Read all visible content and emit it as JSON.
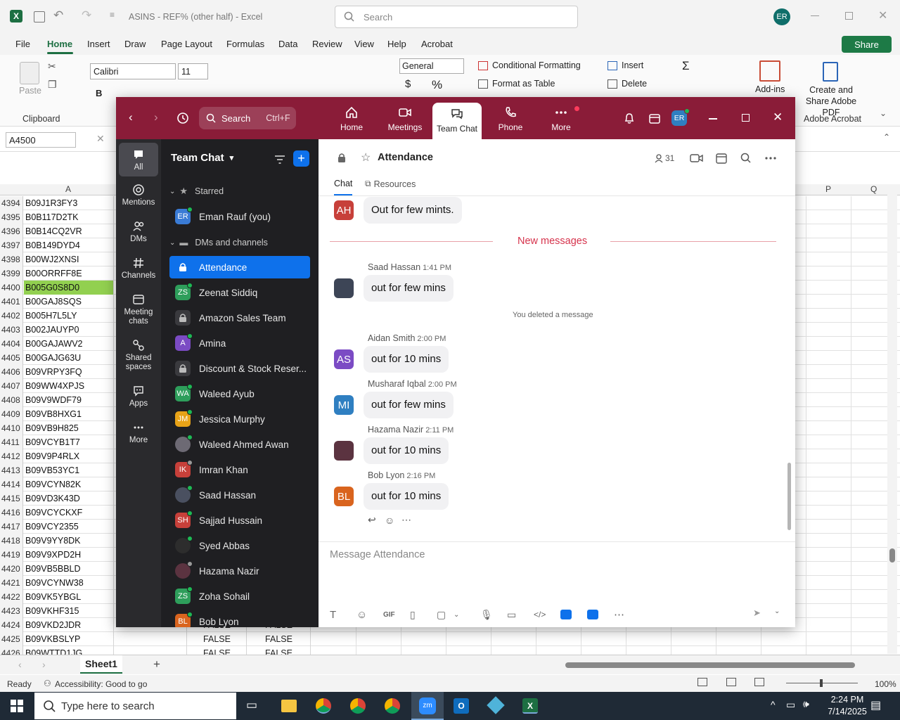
{
  "excel": {
    "title": "ASINS - REF% (other half)  -  Excel",
    "search_placeholder": "Search",
    "user_initials": "ER",
    "menu": [
      "File",
      "Home",
      "Insert",
      "Draw",
      "Page Layout",
      "Formulas",
      "Data",
      "Review",
      "View",
      "Help",
      "Acrobat"
    ],
    "share_label": "Share",
    "ribbon": {
      "paste": "Paste",
      "clipboard": "Clipboard",
      "font_name": "Calibri",
      "font_size": "11",
      "number_format": "General",
      "conditional_formatting": "Conditional Formatting",
      "format_as_table": "Format as Table",
      "insert": "Insert",
      "delete": "Delete",
      "addins": "Add-ins",
      "create_share_pdf": "Create and Share Adobe PDF",
      "adobe_acrobat": "Adobe Acrobat"
    },
    "name_box": "A4500",
    "col_a": "A",
    "col_p": "P",
    "col_q": "Q",
    "rows": [
      {
        "n": "4394",
        "a": "B09J1R3FY3"
      },
      {
        "n": "4395",
        "a": "B0B117D2TK"
      },
      {
        "n": "4396",
        "a": "B0B14CQ2VR"
      },
      {
        "n": "4397",
        "a": "B0B149DYD4"
      },
      {
        "n": "4398",
        "a": "B00WJ2XNSI"
      },
      {
        "n": "4399",
        "a": "B00ORRFF8E"
      },
      {
        "n": "4400",
        "a": "B005G0S8D0"
      },
      {
        "n": "4401",
        "a": "B00GAJ8SQS"
      },
      {
        "n": "4402",
        "a": "B005H7L5LY"
      },
      {
        "n": "4403",
        "a": "B002JAUYP0"
      },
      {
        "n": "4404",
        "a": "B00GAJAWV2"
      },
      {
        "n": "4405",
        "a": "B00GAJG63U"
      },
      {
        "n": "4406",
        "a": "B09VRPY3FQ"
      },
      {
        "n": "4407",
        "a": "B09WW4XPJS"
      },
      {
        "n": "4408",
        "a": "B09V9WDF79"
      },
      {
        "n": "4409",
        "a": "B09VB8HXG1"
      },
      {
        "n": "4410",
        "a": "B09VB9H825"
      },
      {
        "n": "4411",
        "a": "B09VCYB1T7"
      },
      {
        "n": "4412",
        "a": "B09V9P4RLX"
      },
      {
        "n": "4413",
        "a": "B09VB53YC1"
      },
      {
        "n": "4414",
        "a": "B09VCYN82K"
      },
      {
        "n": "4415",
        "a": "B09VD3K43D"
      },
      {
        "n": "4416",
        "a": "B09VCYCKXF"
      },
      {
        "n": "4417",
        "a": "B09VCY2355"
      },
      {
        "n": "4418",
        "a": "B09V9YY8DK"
      },
      {
        "n": "4419",
        "a": "B09V9XPD2H"
      },
      {
        "n": "4420",
        "a": "B09VB5BBLD"
      },
      {
        "n": "4421",
        "a": "B09VCYNW38"
      },
      {
        "n": "4422",
        "a": "B09VK5YBGL"
      },
      {
        "n": "4423",
        "a": "B09VKHF315"
      },
      {
        "n": "4424",
        "a": "B09VKD2JDR",
        "c": "FALSE",
        "d": "FALSE"
      },
      {
        "n": "4425",
        "a": "B09VKBSLYP",
        "c": "FALSE",
        "d": "FALSE"
      },
      {
        "n": "4426",
        "a": "B09WTTD1JG",
        "c": "FALSE",
        "d": "FALSE"
      }
    ],
    "sheet_tab": "Sheet1",
    "status_ready": "Ready",
    "accessibility": "Accessibility: Good to go",
    "zoom_pct": "100%",
    "highlight_color": "#92d050"
  },
  "zoom": {
    "search_label": "Search",
    "search_shortcut": "Ctrl+F",
    "nav": [
      "Home",
      "Meetings",
      "Team Chat",
      "Phone",
      "More"
    ],
    "avatar": "ER",
    "rail": [
      "All",
      "Mentions",
      "DMs",
      "Channels",
      "Meeting chats",
      "Shared spaces",
      "Apps",
      "More"
    ],
    "list_title": "Team Chat",
    "section_starred": "Starred",
    "section_dms": "DMs and channels",
    "starred_self": {
      "initials": "ER",
      "name": "Eman Rauf (you)",
      "color": "#3a7bd5"
    },
    "channels": [
      {
        "initials": "",
        "name": "Attendance",
        "type": "lock",
        "color": "#ffffff",
        "status": ""
      },
      {
        "initials": "ZS",
        "name": "Zeenat Siddiq",
        "type": "user",
        "color": "#2e9e5b",
        "status": "#1db954"
      },
      {
        "initials": "",
        "name": "Amazon Sales Team",
        "type": "lock",
        "color": "#3a3a3e",
        "status": ""
      },
      {
        "initials": "A",
        "name": "Amina",
        "type": "user",
        "color": "#7b4bc4",
        "status": "#1db954"
      },
      {
        "initials": "",
        "name": "Discount & Stock Reser...",
        "type": "lock",
        "color": "#3a3a3e",
        "status": ""
      },
      {
        "initials": "WA",
        "name": "Waleed Ayub",
        "type": "user",
        "color": "#2e9e5b",
        "status": "#1db954"
      },
      {
        "initials": "JM",
        "name": "Jessica Murphy",
        "type": "user",
        "color": "#e8a317",
        "status": "#1db954"
      },
      {
        "initials": "",
        "name": "Waleed Ahmed Awan",
        "type": "photo",
        "color": "#6d6a74",
        "status": "#1db954"
      },
      {
        "initials": "IK",
        "name": "Imran Khan",
        "type": "user",
        "color": "#c7403a",
        "status": "#9a9a9a"
      },
      {
        "initials": "",
        "name": "Saad Hassan",
        "type": "photo",
        "color": "#4a5060",
        "status": "#1db954"
      },
      {
        "initials": "SH",
        "name": "Sajjad Hussain",
        "type": "user",
        "color": "#c7403a",
        "status": "#1db954"
      },
      {
        "initials": "",
        "name": "Syed Abbas",
        "type": "photo",
        "color": "#2d2d2d",
        "status": "#1db954"
      },
      {
        "initials": "",
        "name": "Hazama Nazir",
        "type": "photo",
        "color": "#5b3340",
        "status": "#9a9a9a"
      },
      {
        "initials": "ZS",
        "name": "Zoha Sohail",
        "type": "user",
        "color": "#2e9e5b",
        "status": "#1db954"
      },
      {
        "initials": "BL",
        "name": "Bob Lyon",
        "type": "user",
        "color": "#d9641e",
        "status": "#1db954"
      }
    ],
    "chat_title": "Attendance",
    "member_count": "31",
    "tab_chat": "Chat",
    "tab_resources": "Resources",
    "first_msg": {
      "initials": "AH",
      "text": "Out for few mints.",
      "color": "#c7403a"
    },
    "new_messages": "New messages",
    "deleted_note": "You deleted a message",
    "messages": [
      {
        "sender": "Saad Hassan",
        "time": "1:41 PM",
        "text": "out for few mins",
        "initials": "",
        "color": "#3d4556"
      },
      {
        "sender": "Aidan Smith",
        "time": "2:00 PM",
        "text": "out for 10 mins",
        "initials": "AS",
        "color": "#7b4bc4"
      },
      {
        "sender": "Musharaf Iqbal",
        "time": "2:00 PM",
        "text": "out for few mins",
        "initials": "MI",
        "color": "#2f7fc1"
      },
      {
        "sender": "Hazama Nazir",
        "time": "2:11 PM",
        "text": "out for 10 mins",
        "initials": "",
        "color": "#5b3340"
      },
      {
        "sender": "Bob Lyon",
        "time": "2:16 PM",
        "text": "out for 10 mins",
        "initials": "BL",
        "color": "#d9641e"
      }
    ],
    "composer_placeholder": "Message Attendance",
    "gif_label": "GIF",
    "accent": "#8a1c38",
    "active_blue": "#0e71eb"
  },
  "taskbar": {
    "search_placeholder": "Type here to search",
    "time": "2:24 PM",
    "date": "7/14/2025"
  }
}
